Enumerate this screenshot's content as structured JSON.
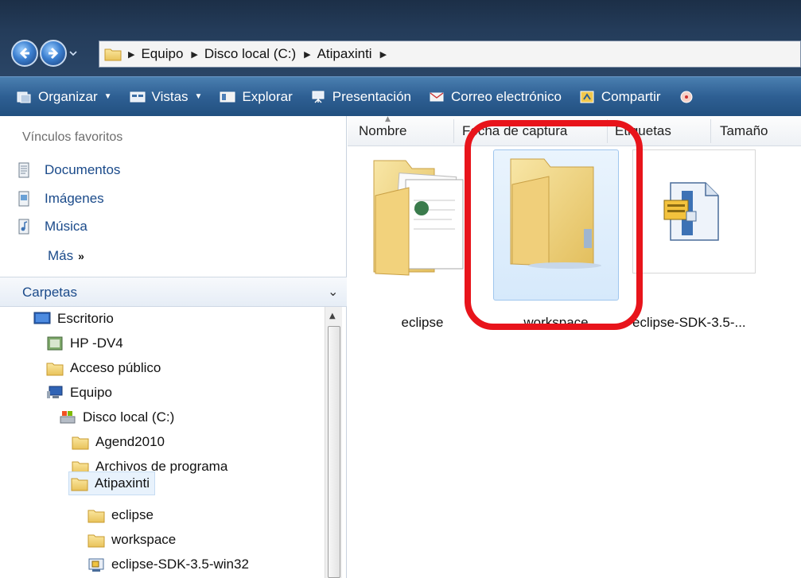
{
  "window": {
    "breadcrumbs": [
      "Equipo",
      "Disco local (C:)",
      "Atipaxinti"
    ]
  },
  "toolbar": {
    "organize": "Organizar",
    "views": "Vistas",
    "explore": "Explorar",
    "presentation": "Presentación",
    "email": "Correo electrónico",
    "share": "Compartir"
  },
  "sidebar": {
    "favorites_title": "Vínculos favoritos",
    "favorites": [
      "Documentos",
      "Imágenes",
      "Música"
    ],
    "more": "Más",
    "more_glyph": "»",
    "folders_title": "Carpetas",
    "tree": [
      {
        "label": "Escritorio",
        "icon": "desktop-icon"
      },
      {
        "label": "HP -DV4",
        "icon": "user-icon"
      },
      {
        "label": "Acceso público",
        "icon": "folder-icon"
      },
      {
        "label": "Equipo",
        "icon": "computer-icon"
      },
      {
        "label": "Disco local (C:)",
        "icon": "drive-icon"
      },
      {
        "label": "Agend2010",
        "icon": "folder-icon"
      },
      {
        "label": "Archivos de programa",
        "icon": "folder-icon"
      },
      {
        "label": "Atipaxinti",
        "icon": "folder-icon"
      },
      {
        "label": "eclipse",
        "icon": "folder-icon"
      },
      {
        "label": "workspace",
        "icon": "folder-icon"
      },
      {
        "label": "eclipse-SDK-3.5-win32",
        "icon": "zip-icon"
      }
    ]
  },
  "content": {
    "columns": [
      "Nombre",
      "Fecha de captura",
      "Etiquetas",
      "Tamaño"
    ],
    "items": [
      {
        "label": "eclipse",
        "icon": "folder-with-documents-icon"
      },
      {
        "label": "workspace",
        "icon": "empty-folder-icon"
      },
      {
        "label": "eclipse-SDK-3.5-...",
        "icon": "zip-archive-icon"
      }
    ]
  },
  "colors": {
    "highlight": "#e8141b",
    "link": "#1a4a8a",
    "toolbar": "#2e5f93"
  }
}
